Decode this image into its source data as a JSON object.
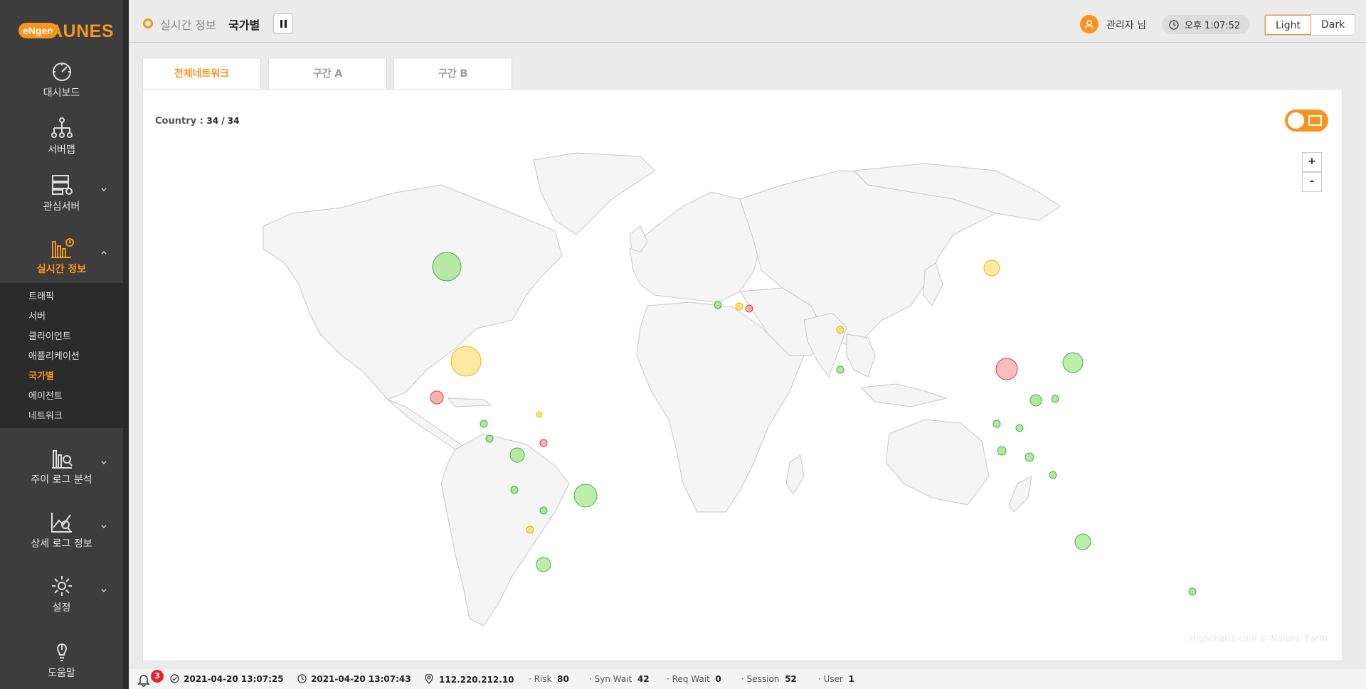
{
  "brand": {
    "badge": "eNgen",
    "name": "AUNES",
    "color": "#f7941d"
  },
  "sidebar": {
    "items": [
      {
        "label": "대시보드",
        "icon": "dashboard-gauge-icon"
      },
      {
        "label": "서버맵",
        "icon": "server-map-icon"
      },
      {
        "label": "관심서버",
        "icon": "server-watch-icon"
      },
      {
        "label": "실시간 정보",
        "icon": "realtime-chart-icon"
      },
      {
        "label": "주이 로그 분석",
        "icon": "log-analysis-icon"
      },
      {
        "label": "상세 로그 정보",
        "icon": "detail-log-icon"
      },
      {
        "label": "설정",
        "icon": "settings-gear-icon"
      },
      {
        "label": "도움말",
        "icon": "help-bulb-icon"
      }
    ],
    "submenu": [
      "트래픽",
      "서버",
      "클라이언트",
      "애플리케이션",
      "국가별",
      "에이전트",
      "네트워크"
    ],
    "active_submenu": "국가별"
  },
  "header": {
    "crumb1": "실시간 정보",
    "crumb2": "국가별",
    "user": "관리자 님",
    "time": "오후 1:07:52",
    "theme_light": "Light",
    "theme_dark": "Dark"
  },
  "tabs": [
    "전체네트워크",
    "구간 A",
    "구간 B"
  ],
  "map": {
    "country_label": "Country :",
    "country_value": "34 / 34",
    "zoom_in": "+",
    "zoom_out": "-",
    "credits": "Highcharts.com © Natural Earth",
    "colors": {
      "good": "#7ed957",
      "warn": "#ffd54a",
      "bad": "#f47c7c"
    }
  },
  "statusbar": {
    "notifications": "3",
    "start_time": "2021-04-20 13:07:25",
    "end_time": "2021-04-20 13:07:43",
    "ip": "112.220.212.10",
    "risk_label": "· Risk",
    "risk": "80",
    "synwait_label": "· Syn Wait",
    "synwait": "42",
    "reqwait_label": "· Req Wait",
    "reqwait": "0",
    "session_label": "· Session",
    "session": "52",
    "user_label": "· User",
    "user": "1"
  }
}
